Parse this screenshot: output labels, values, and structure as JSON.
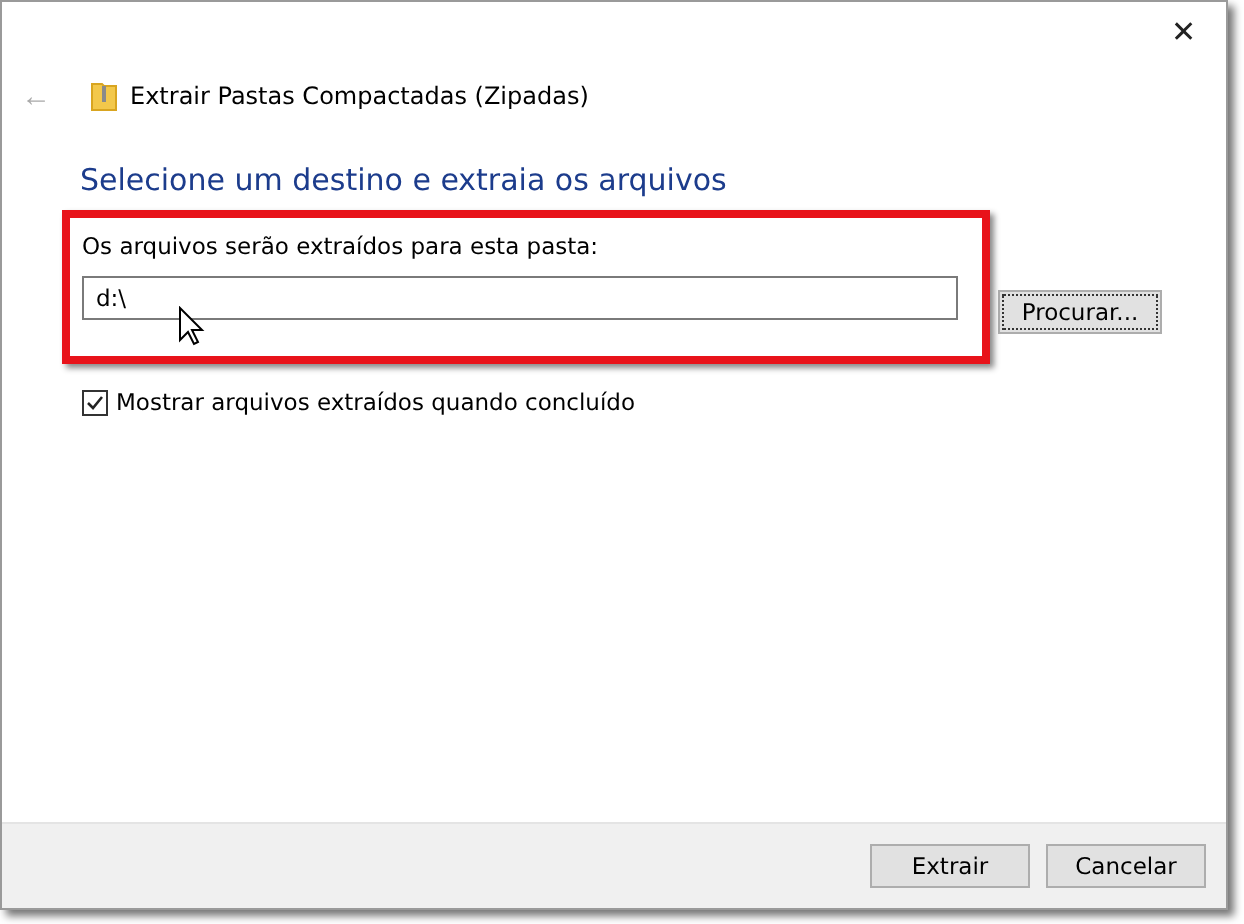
{
  "window": {
    "title": "Extrair Pastas Compactadas (Zipadas)",
    "close": "✕",
    "back": "←"
  },
  "heading": "Selecione um destino e extraia os arquivos",
  "destination": {
    "label": "Os arquivos serão extraídos para esta pasta:",
    "value": "d:\\",
    "highlighted": true
  },
  "browse_button": "Procurar...",
  "show_files": {
    "label": "Mostrar arquivos extraídos quando concluído",
    "checked": true
  },
  "buttons": [
    {
      "label": "Extrair"
    },
    {
      "label": "Cancelar"
    }
  ]
}
